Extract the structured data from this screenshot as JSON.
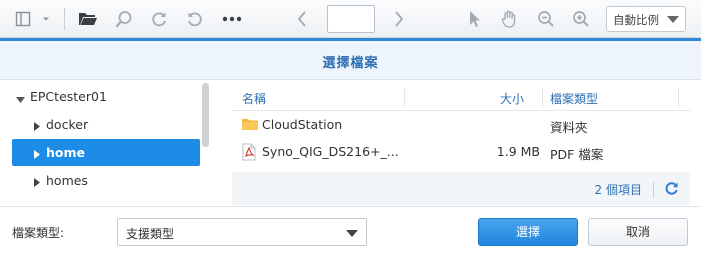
{
  "toolbar": {
    "page_value": "",
    "zoom_value": "自動比例"
  },
  "dialog": {
    "title": "選擇檔案"
  },
  "tree": {
    "items": [
      {
        "label": "EPCtester01",
        "expanded": true,
        "selected": false
      },
      {
        "label": "docker",
        "expanded": false,
        "selected": false
      },
      {
        "label": "home",
        "expanded": false,
        "selected": true
      },
      {
        "label": "homes",
        "expanded": false,
        "selected": false
      }
    ]
  },
  "list": {
    "columns": {
      "name": "名稱",
      "size": "大小",
      "type": "檔案類型"
    },
    "rows": [
      {
        "icon": "folder-icon",
        "name": "CloudStation",
        "size": "",
        "type": "資料夾"
      },
      {
        "icon": "pdf-icon",
        "name": "Syno_QIG_DS216+_...",
        "size": "1.9 MB",
        "type": "PDF 檔案"
      }
    ],
    "item_count": "2 個項目"
  },
  "bottom": {
    "filetype_label": "檔案類型:",
    "filetype_value": "支援類型",
    "ok_label": "選擇",
    "cancel_label": "取消"
  },
  "colors": {
    "accent": "#1c8ce6",
    "header_text": "#2f6fb5",
    "link_text": "#2d6fb3"
  }
}
